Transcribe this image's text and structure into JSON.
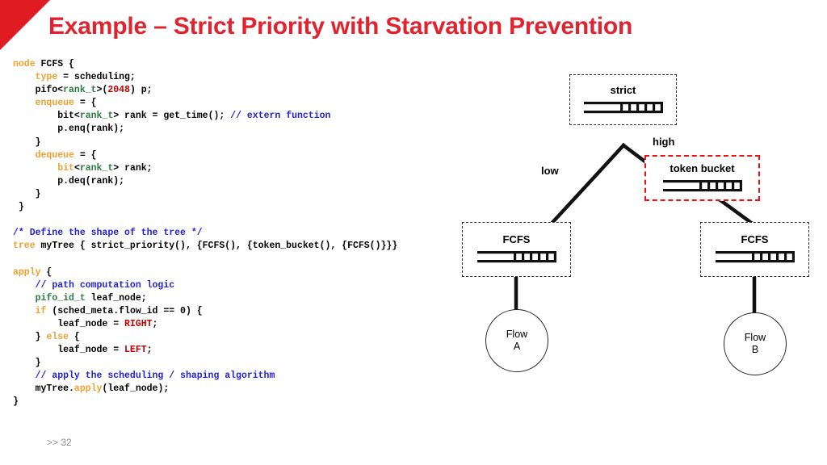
{
  "slide": {
    "title": "Example – Strict Priority with Starvation Prevention",
    "title_color": "#e0232e",
    "accent_color": "#e01b24",
    "page_marker": ">> 32"
  },
  "code": {
    "language": "domain-specific scheduling language",
    "lines": [
      [
        {
          "t": "node",
          "c": "kw"
        },
        {
          "t": " FCFS {",
          "c": "pln"
        }
      ],
      [
        {
          "t": "    ",
          "c": "pln"
        },
        {
          "t": "type",
          "c": "kw"
        },
        {
          "t": " = scheduling;",
          "c": "pln"
        }
      ],
      [
        {
          "t": "    pifo<",
          "c": "pln"
        },
        {
          "t": "rank_t",
          "c": "type"
        },
        {
          "t": ">(",
          "c": "pln"
        },
        {
          "t": "2048",
          "c": "num"
        },
        {
          "t": ") p;",
          "c": "pln"
        }
      ],
      [
        {
          "t": "    ",
          "c": "pln"
        },
        {
          "t": "enqueue",
          "c": "kw"
        },
        {
          "t": " = {",
          "c": "pln"
        }
      ],
      [
        {
          "t": "        bit<",
          "c": "pln"
        },
        {
          "t": "rank_t",
          "c": "type"
        },
        {
          "t": "> rank = get_time(); ",
          "c": "pln"
        },
        {
          "t": "// extern function",
          "c": "com"
        }
      ],
      [
        {
          "t": "        p.enq(rank);",
          "c": "pln"
        }
      ],
      [
        {
          "t": "    }",
          "c": "pln"
        }
      ],
      [
        {
          "t": "    ",
          "c": "pln"
        },
        {
          "t": "dequeue",
          "c": "kw"
        },
        {
          "t": " = {",
          "c": "pln"
        }
      ],
      [
        {
          "t": "        ",
          "c": "pln"
        },
        {
          "t": "bit",
          "c": "kw"
        },
        {
          "t": "<",
          "c": "pln"
        },
        {
          "t": "rank_t",
          "c": "type"
        },
        {
          "t": "> rank;",
          "c": "pln"
        }
      ],
      [
        {
          "t": "        p.deq(rank);",
          "c": "pln"
        }
      ],
      [
        {
          "t": "    }",
          "c": "pln"
        }
      ],
      [
        {
          "t": " }",
          "c": "pln"
        }
      ],
      [
        {
          "t": "",
          "c": "pln"
        }
      ],
      [
        {
          "t": "/* Define the shape of the tree */",
          "c": "com"
        }
      ],
      [
        {
          "t": "tree",
          "c": "kw"
        },
        {
          "t": " myTree { strict_priority(), {FCFS(), {token_bucket(), {FCFS()}}}",
          "c": "pln"
        }
      ],
      [
        {
          "t": "",
          "c": "pln"
        }
      ],
      [
        {
          "t": "apply",
          "c": "kw"
        },
        {
          "t": " {",
          "c": "pln"
        }
      ],
      [
        {
          "t": "    ",
          "c": "pln"
        },
        {
          "t": "// path computation logic",
          "c": "com"
        }
      ],
      [
        {
          "t": "    ",
          "c": "pln"
        },
        {
          "t": "pifo_id_t",
          "c": "type"
        },
        {
          "t": " leaf_node;",
          "c": "pln"
        }
      ],
      [
        {
          "t": "    ",
          "c": "pln"
        },
        {
          "t": "if",
          "c": "kw"
        },
        {
          "t": " (sched_meta.flow_id == 0) {",
          "c": "pln"
        }
      ],
      [
        {
          "t": "        leaf_node = ",
          "c": "pln"
        },
        {
          "t": "RIGHT",
          "c": "num"
        },
        {
          "t": ";",
          "c": "pln"
        }
      ],
      [
        {
          "t": "    } ",
          "c": "pln"
        },
        {
          "t": "else",
          "c": "kw"
        },
        {
          "t": " {",
          "c": "pln"
        }
      ],
      [
        {
          "t": "        leaf_node = ",
          "c": "pln"
        },
        {
          "t": "LEFT",
          "c": "num"
        },
        {
          "t": ";",
          "c": "pln"
        }
      ],
      [
        {
          "t": "    }",
          "c": "pln"
        }
      ],
      [
        {
          "t": "    ",
          "c": "pln"
        },
        {
          "t": "// apply the scheduling / shaping algorithm",
          "c": "com"
        }
      ],
      [
        {
          "t": "    myTree.",
          "c": "pln"
        },
        {
          "t": "apply",
          "c": "kw"
        },
        {
          "t": "(leaf_node);",
          "c": "pln"
        }
      ],
      [
        {
          "t": "}",
          "c": "pln"
        }
      ]
    ],
    "colors": {
      "keyword": "#f0a030",
      "type": "#2a7d3f",
      "constant": "#c00000",
      "comment": "#2222dd",
      "plain": "#000000"
    }
  },
  "tree": {
    "nodes": {
      "strict": {
        "label": "strict",
        "border": "dashed-black",
        "queue_cells": 5
      },
      "token_bucket": {
        "label": "token bucket",
        "border": "dashed-red",
        "queue_cells": 5
      },
      "fcfs_left": {
        "label": "FCFS",
        "border": "dashed-black",
        "queue_cells": 5
      },
      "fcfs_right": {
        "label": "FCFS",
        "border": "dashed-black",
        "queue_cells": 5
      }
    },
    "edge_labels": {
      "low": "low",
      "high": "high"
    },
    "leaves": {
      "flow_a": {
        "line1": "Flow",
        "line2": "A"
      },
      "flow_b": {
        "line1": "Flow",
        "line2": "B"
      }
    },
    "highlight_color": "#ee1111",
    "border_color": "#333333"
  }
}
